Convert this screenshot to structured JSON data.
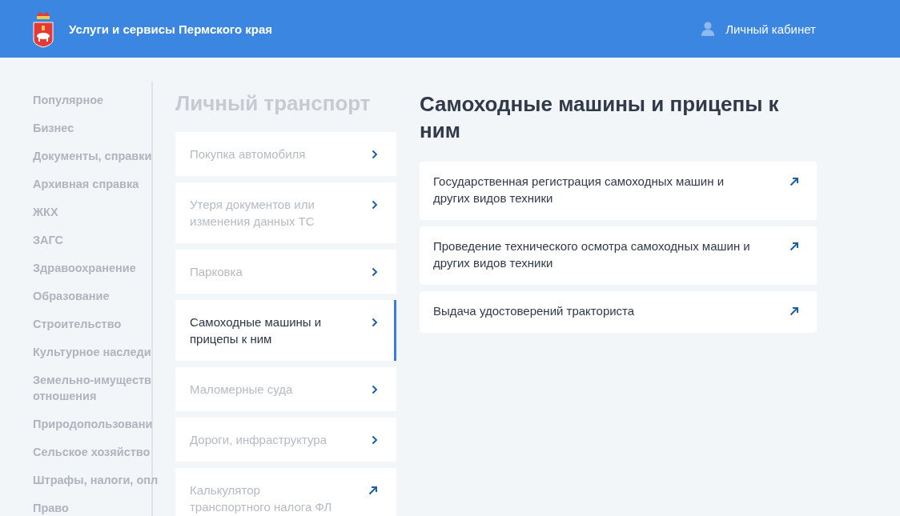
{
  "header": {
    "title": "Услуги и сервисы Пермского края",
    "account": "Личный кабинет"
  },
  "sidebar": {
    "items": [
      {
        "label": "Популярное"
      },
      {
        "label": "Бизнес"
      },
      {
        "label": "Документы, справки"
      },
      {
        "label": "Архивная справка"
      },
      {
        "label": "ЖКХ"
      },
      {
        "label": "ЗАГС"
      },
      {
        "label": "Здравоохранение"
      },
      {
        "label": "Образование"
      },
      {
        "label": "Строительство"
      },
      {
        "label": "Культурное наследи"
      },
      {
        "label": "Земельно-имуществ\nотношения"
      },
      {
        "label": "Природопользовани"
      },
      {
        "label": "Сельское хозяйство"
      },
      {
        "label": "Штрафы, налоги, опл"
      },
      {
        "label": "Право"
      }
    ]
  },
  "category": {
    "title": "Личный транспорт",
    "items": [
      {
        "label": "Покупка автомобиля",
        "kind": "chevron",
        "selected": false
      },
      {
        "label": "Утеря документов или изменения данных ТС",
        "kind": "chevron",
        "selected": false
      },
      {
        "label": "Парковка",
        "kind": "chevron",
        "selected": false
      },
      {
        "label": "Самоходные машины и прицепы к ним",
        "kind": "chevron",
        "selected": true
      },
      {
        "label": "Маломерные суда",
        "kind": "chevron",
        "selected": false
      },
      {
        "label": "Дороги, инфраструктура",
        "kind": "chevron",
        "selected": false
      },
      {
        "label": "Калькулятор транспортного налога ФЛ",
        "kind": "external",
        "selected": false
      }
    ]
  },
  "detail": {
    "title": "Самоходные машины и прицепы к ним",
    "services": [
      {
        "label": "Государственная регистрация самоходных машин и других видов техники"
      },
      {
        "label": "Проведение технического осмотра самоходных машин и других видов техники"
      },
      {
        "label": "Выдача удостоверений тракториста"
      }
    ]
  }
}
